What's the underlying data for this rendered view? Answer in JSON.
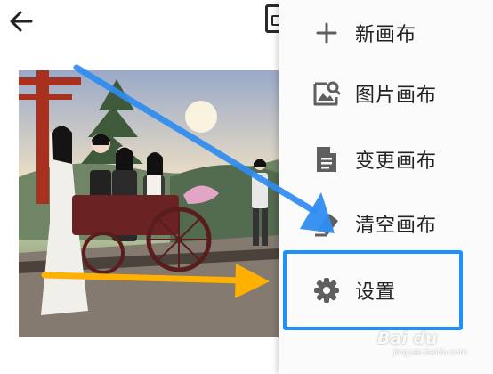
{
  "menu": {
    "items": [
      {
        "label": "新画布",
        "icon": "plus-icon"
      },
      {
        "label": "图片画布",
        "icon": "image-search-icon"
      },
      {
        "label": "变更画布",
        "icon": "document-icon"
      },
      {
        "label": "清空画布",
        "icon": "eraser-icon"
      },
      {
        "label": "设置",
        "icon": "gear-icon"
      }
    ]
  },
  "toolbar": {
    "back_icon": "arrow-left-icon",
    "partial_icon": "canvas-icon"
  },
  "annotations": {
    "highlight_color": "#1e90ff",
    "blue_arrow_color": "#2f8cf0",
    "orange_arrow_color": "#ffb000"
  },
  "watermark": {
    "logo": "Bai du",
    "sub": "jingyan.baidu.com"
  }
}
